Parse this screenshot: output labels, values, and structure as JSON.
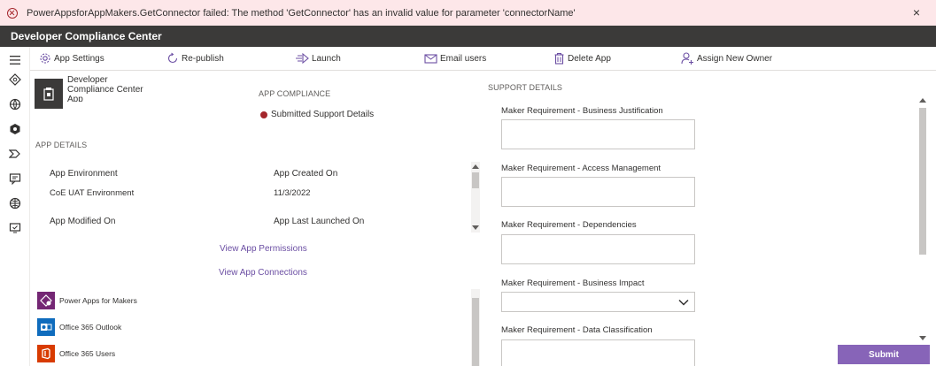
{
  "error": {
    "message": "PowerAppsforAppMakers.GetConnector failed: The method 'GetConnector' has an invalid value for parameter 'connectorName'",
    "close_glyph": "×"
  },
  "app": {
    "title": "Developer Compliance Center"
  },
  "commands": [
    {
      "label": "App Settings",
      "icon": "gear-icon"
    },
    {
      "label": "Re-publish",
      "icon": "refresh-icon"
    },
    {
      "label": "Launch",
      "icon": "launch-icon"
    },
    {
      "label": "Email users",
      "icon": "mail-icon"
    },
    {
      "label": "Delete App",
      "icon": "trash-icon"
    },
    {
      "label": "Assign New Owner",
      "icon": "person-add-icon"
    }
  ],
  "app_info": {
    "name": "Developer Compliance Center App"
  },
  "app_compliance": {
    "heading": "APP COMPLIANCE",
    "status": "Submitted Support Details",
    "status_color": "#a4262c"
  },
  "app_details": {
    "heading": "APP DETAILS",
    "environment_label": "App Environment",
    "environment_value": "CoE UAT Environment",
    "created_label": "App Created On",
    "created_value": "11/3/2022",
    "modified_label": "App Modified On",
    "launched_label": "App Last Launched On"
  },
  "links": {
    "permissions": "View App Permissions",
    "connections": "View App Connections"
  },
  "connections": [
    {
      "name": "Power Apps for Makers",
      "color": "#742774"
    },
    {
      "name": "Office 365 Outlook",
      "color": "#0f6cbd"
    },
    {
      "name": "Office 365 Users",
      "color": "#d83b01"
    }
  ],
  "support": {
    "heading": "SUPPORT DETAILS",
    "fields": [
      {
        "label": "Maker Requirement - Business Justification"
      },
      {
        "label": "Maker Requirement - Access Management"
      },
      {
        "label": "Maker Requirement - Dependencies"
      },
      {
        "label": "Maker Requirement - Business Impact"
      },
      {
        "label": "Maker Requirement - Data Classification"
      }
    ]
  },
  "submit_label": "Submit",
  "colors": {
    "accent": "#8764b8",
    "link": "#6b4ea3",
    "titlebar": "#3b3a39",
    "error_bg": "#fde7e9"
  }
}
